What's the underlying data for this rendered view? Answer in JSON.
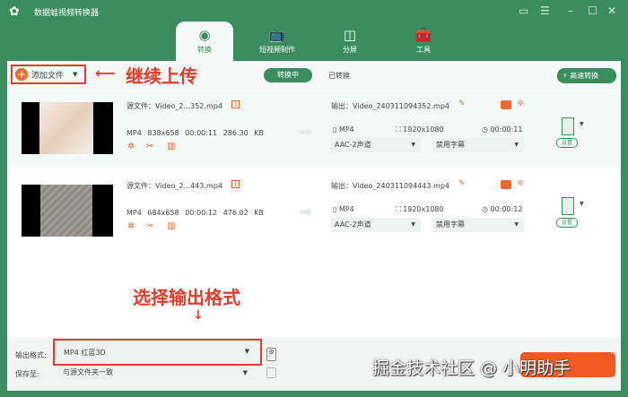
{
  "app": {
    "title": "数据蛙视频转换器"
  },
  "tabs": [
    {
      "label": "转换",
      "icon": "convert-icon"
    },
    {
      "label": "短视频制作",
      "icon": "tv-icon"
    },
    {
      "label": "分屏",
      "icon": "split-screen-icon"
    },
    {
      "label": "工具",
      "icon": "toolbox-icon"
    }
  ],
  "toolbar": {
    "add_file": "添加文件",
    "converting": "转换中",
    "converted": "已转换",
    "fast_convert": "高速转换"
  },
  "annotations": {
    "continue_upload": "继续上传",
    "choose_format": "选择输出格式"
  },
  "files": [
    {
      "source": "源文件：Video_2...352.mp4",
      "format": "MP4",
      "resolution": "838x658",
      "duration": "00:00:11",
      "size": "286.30 KB",
      "output": "输出：Video_240311094352.mp4",
      "out_format": "MP4",
      "out_resolution": "1920x1080",
      "out_duration": "00:00:11",
      "audio": "AAC-2声道",
      "subtitle": "禁用字幕",
      "settings": "设置"
    },
    {
      "source": "源文件：Video_2...443.mp4",
      "format": "MP4",
      "resolution": "684x658",
      "duration": "00:00:12",
      "size": "476.02 KB",
      "output": "输出：Video_240311094443.mp4",
      "out_format": "MP4",
      "out_resolution": "1920x1080",
      "out_duration": "00:00:12",
      "audio": "AAC-2声道",
      "subtitle": "禁用字幕",
      "settings": "设置"
    }
  ],
  "bottom": {
    "format_label": "输出格式:",
    "format_value": "MP4 红蓝3D",
    "save_label": "保存至:",
    "save_value": "与源文件夹一致"
  },
  "watermark": "掘金技术社区 @ 小明助手",
  "colors": {
    "brand": "#3a8d5f",
    "accent": "#e8652c",
    "annotation": "#e53b2c"
  }
}
